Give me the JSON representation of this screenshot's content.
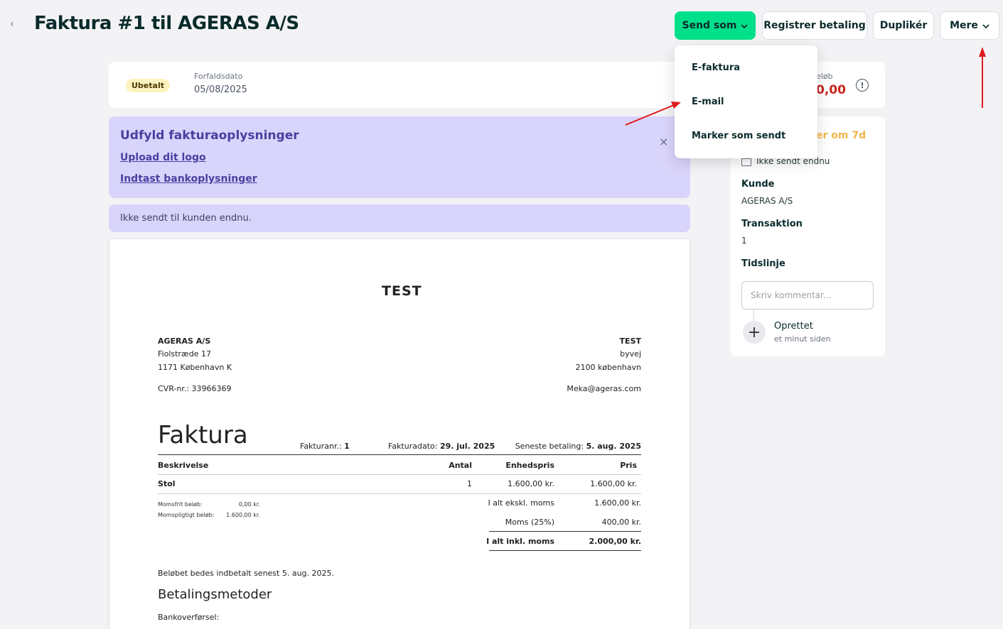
{
  "header": {
    "back_glyph": "‹",
    "title": "Faktura #1 til AGERAS A/S",
    "send_label": "Send som",
    "register_label": "Registrer betaling",
    "duplicate_label": "Duplikér",
    "more_label": "Mere",
    "chevron": "⌄"
  },
  "status": {
    "badge": "Ubetalt",
    "due_label": "Forfaldsdato",
    "due_value": "05/08/2025",
    "amount_label": "eløb",
    "amount_value": "0,00",
    "info_glyph": "!"
  },
  "onboarding": {
    "title": "Udfyld fakturaoplysninger",
    "links": [
      "Upload dit logo",
      "Indtast bankoplysninger"
    ],
    "close": "×"
  },
  "notice": "Ikke sendt til kunden endnu.",
  "invoice": {
    "heading": "TEST",
    "buyer": [
      "AGERAS A/S",
      "Fiolstræde 17",
      "1171 København K"
    ],
    "buyer_cvr": "CVR-nr.: 33966369",
    "seller": [
      "TEST",
      "byvej",
      "2100 københavn"
    ],
    "seller_email": "Meka@ageras.com",
    "doc_type": "Faktura",
    "invoice_no_label": "Fakturanr.:",
    "invoice_no": "1",
    "invoice_date_label": "Fakturadato:",
    "invoice_date": "29. jul. 2025",
    "last_payment_label": "Seneste betaling:",
    "last_payment": "5. aug. 2025",
    "columns": [
      "Beskrivelse",
      "Antal",
      "Enhedspris",
      "Pris"
    ],
    "rows": [
      {
        "desc": "Stol",
        "qty": "1",
        "unit": "1.600,00 kr.",
        "price": "1.600,00 kr."
      }
    ],
    "vat_free_label": "Momsfrit beløb:",
    "vat_free": "0,00 kr.",
    "vat_liable_label": "Momspligtigt beløb:",
    "vat_liable": "1.600,00 kr.",
    "subtotal_label": "I alt ekskl. moms",
    "subtotal": "1.600,00 kr.",
    "vat_label": "Moms (25%)",
    "vat": "400,00 kr.",
    "total_label": "I alt inkl. moms",
    "total": "2.000,00 kr.",
    "payment_note": "Beløbet bedes indbetalt senest 5. aug. 2025.",
    "payment_methods_title": "Betalingsmetoder",
    "bank_transfer_label": "Bankoverførsel:"
  },
  "dropdown": {
    "items": [
      "E-faktura",
      "E-mail",
      "Marker som sendt"
    ]
  },
  "side": {
    "status_partial": "er om 7d",
    "sent_status": "Ikke sendt endnu",
    "customer_label": "Kunde",
    "customer_value": "AGERAS A/S",
    "transaction_label": "Transaktion",
    "transaction_value": "1",
    "timeline_label": "Tidslinje",
    "comment_placeholder": "Skriv kommentar...",
    "plus_glyph": "+",
    "timeline_event": "Oprettet",
    "timeline_time": "et minut siden"
  },
  "colors": {
    "send_button": "#00e08a",
    "badge_bg": "#fdf3c1",
    "onboarding_bg": "#d9d4fb",
    "amount": "#c8241b",
    "annotation_arrow": "#e01b1b"
  }
}
